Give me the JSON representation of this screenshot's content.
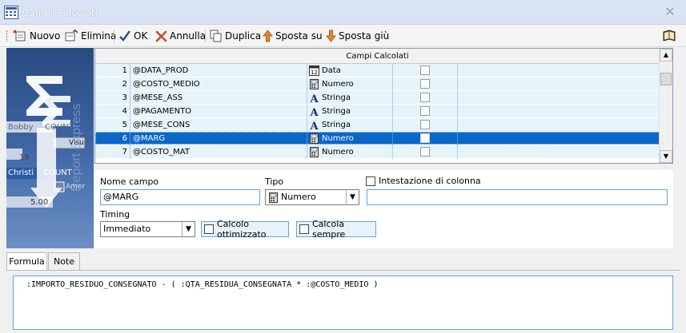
{
  "window": {
    "title": "Campi Calcolati"
  },
  "toolbar": {
    "nuovo": "Nuovo",
    "elimina": "Elimina",
    "ok": "OK",
    "annulla": "Annulla",
    "duplica": "Duplica",
    "sposta_su": "Sposta su",
    "sposta_giu": "Sposta giù"
  },
  "grid": {
    "header": "Campi Calcolati",
    "rows": [
      {
        "num": "1",
        "name": "@DATA_PROD",
        "type": "Data",
        "icon": "calendar-icon"
      },
      {
        "num": "2",
        "name": "@COSTO_MEDIO",
        "type": "Numero",
        "icon": "calculator-icon"
      },
      {
        "num": "3",
        "name": "@MESE_ASS",
        "type": "Stringa",
        "icon": "letter-a-icon"
      },
      {
        "num": "4",
        "name": "@PAGAMENTO",
        "type": "Stringa",
        "icon": "letter-a-icon"
      },
      {
        "num": "5",
        "name": "@MESE_CONS",
        "type": "Stringa",
        "icon": "letter-a-icon"
      },
      {
        "num": "6",
        "name": "@MARG",
        "type": "Numero",
        "icon": "calculator-icon",
        "selected": true
      },
      {
        "num": "7",
        "name": "@COSTO_MAT",
        "type": "Numero",
        "icon": "calculator-icon"
      }
    ]
  },
  "form": {
    "nome_label": "Nome campo",
    "nome_value": "@MARG",
    "tipo_label": "Tipo",
    "tipo_value": "Numero",
    "intestazione_label": "Intestazione di colonna",
    "intestazione_value": "",
    "timing_label": "Timing",
    "timing_value": "Immediato",
    "calcolo_ottimizzato": "Calcolo ottimizzato",
    "calcola_sempre": "Calcola sempre"
  },
  "tabs": [
    "Formula",
    "Note"
  ],
  "formula": ":IMPORTO_RESIDUO_CONSEGNATO - ( :QTA_RESIDUA_CONSEGNATA * :@COSTO_MEDIO )",
  "decoration": {
    "names": [
      "Bobby",
      "COUNT",
      "Christi",
      "COUNT"
    ],
    "values": [
      "19",
      "5.00"
    ],
    "buttons": [
      "Visu",
      "Amer"
    ]
  },
  "colors": {
    "selection": "#0a67c8",
    "row": "#e6f3fb",
    "accent": "#5ea6d9"
  }
}
